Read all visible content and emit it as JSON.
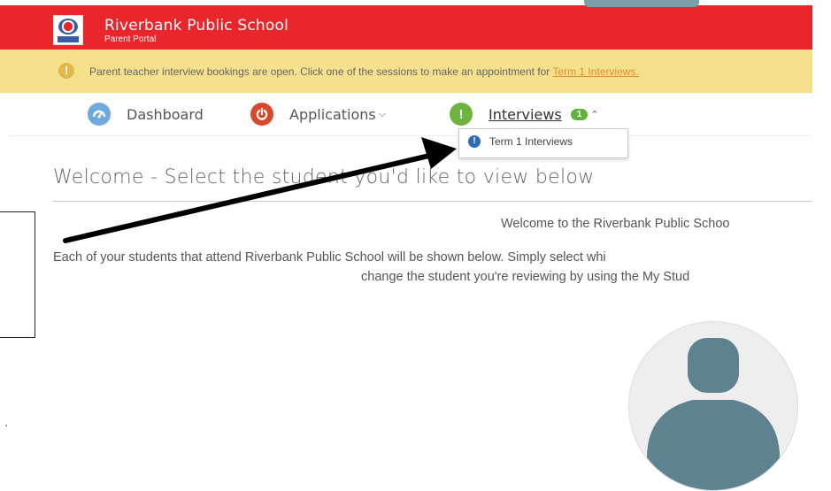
{
  "header": {
    "school_name": "Riverbank Public School",
    "portal_name": "Parent Portal",
    "background_color": "#e8262b"
  },
  "announcement": {
    "icon": "exclamation-icon",
    "text": "Parent teacher interview bookings are open. Click one of the sessions to make an appointment for ",
    "link_text": "Term 1 Interviews.",
    "background_color": "#f5e08c"
  },
  "nav": {
    "items": [
      {
        "label": "Dashboard",
        "icon": "dashboard-icon",
        "icon_color": "#6fa8dc"
      },
      {
        "label": "Applications",
        "icon": "power-icon",
        "icon_color": "#d9482b",
        "has_dropdown": true
      },
      {
        "label": "Interviews",
        "icon": "exclamation-icon",
        "icon_color": "#6cb33f",
        "badge": "1",
        "expanded": true
      }
    ]
  },
  "dropdown": {
    "items": [
      {
        "label": "Term 1 Interviews",
        "icon": "exclamation-icon",
        "icon_color": "#2d6db5"
      }
    ]
  },
  "welcome": {
    "title": "Welcome - Select the student you'd like to view below",
    "line1": "Welcome to the Riverbank Public Schoo",
    "line2": "Each of your students that attend Riverbank Public School will be shown below. Simply select whi",
    "line3": "change the student you're reviewing by using the My Stud"
  },
  "avatar": {
    "icon": "user-silhouette-icon",
    "color": "#5e8290"
  }
}
